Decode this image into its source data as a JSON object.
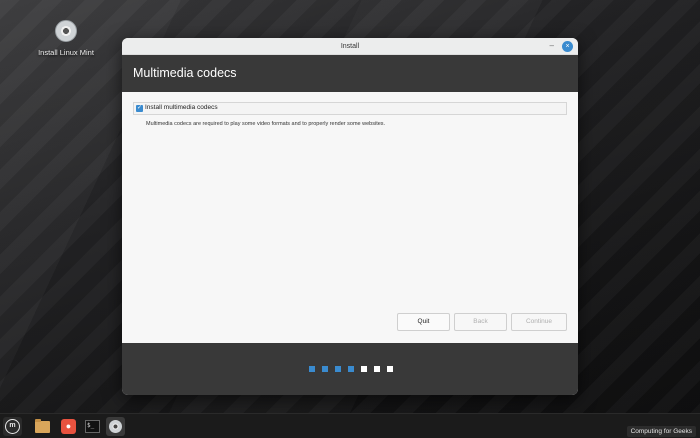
{
  "desktop": {
    "icon_label": "Install Linux Mint",
    "icon_name": "disc-icon"
  },
  "window": {
    "title": "Install",
    "minimize_glyph": "–",
    "close_glyph": "×",
    "page_title": "Multimedia codecs",
    "checkbox": {
      "label": "Install multimedia codecs",
      "checked": true,
      "glyph": "✓"
    },
    "description": "Multimedia codecs are required to play some video formats and to properly render some websites.",
    "buttons": {
      "quit": "Quit",
      "back": "Back",
      "continue": "Continue"
    },
    "progress": {
      "total_steps": 7,
      "completed_steps": 4,
      "color_done": "#3a8bcf",
      "color_todo": "#ffffff"
    }
  },
  "taskbar": {
    "menu_glyph": "m",
    "firefox_glyph": "●",
    "terminal_glyph": "$_",
    "tray_text": "Computing for Geeks"
  },
  "colors": {
    "accent": "#3a8bcf",
    "header": "#393939",
    "window_bg": "#f7f7f7"
  }
}
